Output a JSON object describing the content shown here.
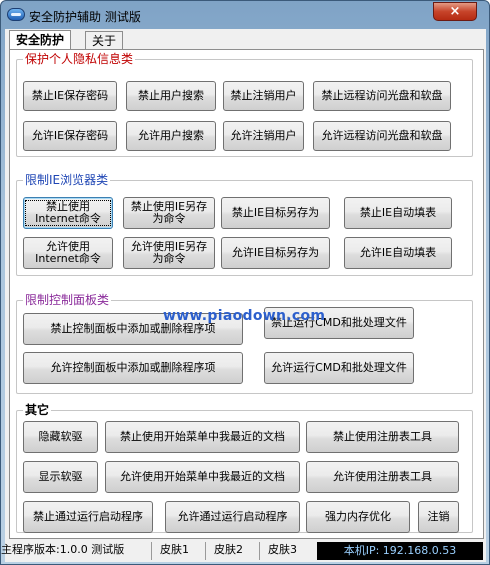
{
  "window": {
    "title": "安全防护辅助  测试版",
    "close_label": "×"
  },
  "tabs": [
    {
      "label": "安全防护",
      "active": true
    },
    {
      "label": "关于",
      "active": false
    }
  ],
  "groups": {
    "privacy": {
      "legend": "保护个人隐私信息类",
      "buttons": [
        "禁止IE保存密码",
        "禁止用户搜索",
        "禁止注销用户",
        "禁止远程访问光盘和软盘",
        "允许IE保存密码",
        "允许用户搜索",
        "允许注销用户",
        "允许远程访问光盘和软盘"
      ]
    },
    "ie": {
      "legend": "限制IE浏览器类",
      "buttons": [
        "禁止使用Internet命令",
        "禁止使用IE另存为命令",
        "禁止IE目标另存为",
        "禁止IE自动填表",
        "允许使用Internet命令",
        "允许使用IE另存为命令",
        "允许IE目标另存为",
        "允许IE自动填表"
      ]
    },
    "control_panel": {
      "legend": "限制控制面板类",
      "buttons": [
        "禁止控制面板中添加或删除程序项",
        "禁止运行CMD和批处理文件",
        "允许控制面板中添加或删除程序项",
        "允许运行CMD和批处理文件"
      ]
    },
    "other": {
      "legend": "其它",
      "buttons": [
        "隐藏软驱",
        "禁止使用开始菜单中我最近的文档",
        "禁止使用注册表工具",
        "显示软驱",
        "允许使用开始菜单中我最近的文档",
        "允许使用注册表工具",
        "禁止通过运行启动程序",
        "允许通过运行启动程序",
        "强力内存优化",
        "注销"
      ]
    }
  },
  "watermark": "www.piaodown.com",
  "statusbar": {
    "version": "主程序版本:1.0.0 测试版",
    "skin1": "皮肤1",
    "skin2": "皮肤2",
    "skin3": "皮肤3",
    "ip": "本机IP: 192.168.0.53"
  },
  "colors": {
    "legend_privacy": "#c00000",
    "legend_ie": "#1e45b4",
    "legend_control_panel": "#8a2a9a",
    "ip_panel_bg": "#000000",
    "ip_panel_text": "#9ad0ff"
  }
}
